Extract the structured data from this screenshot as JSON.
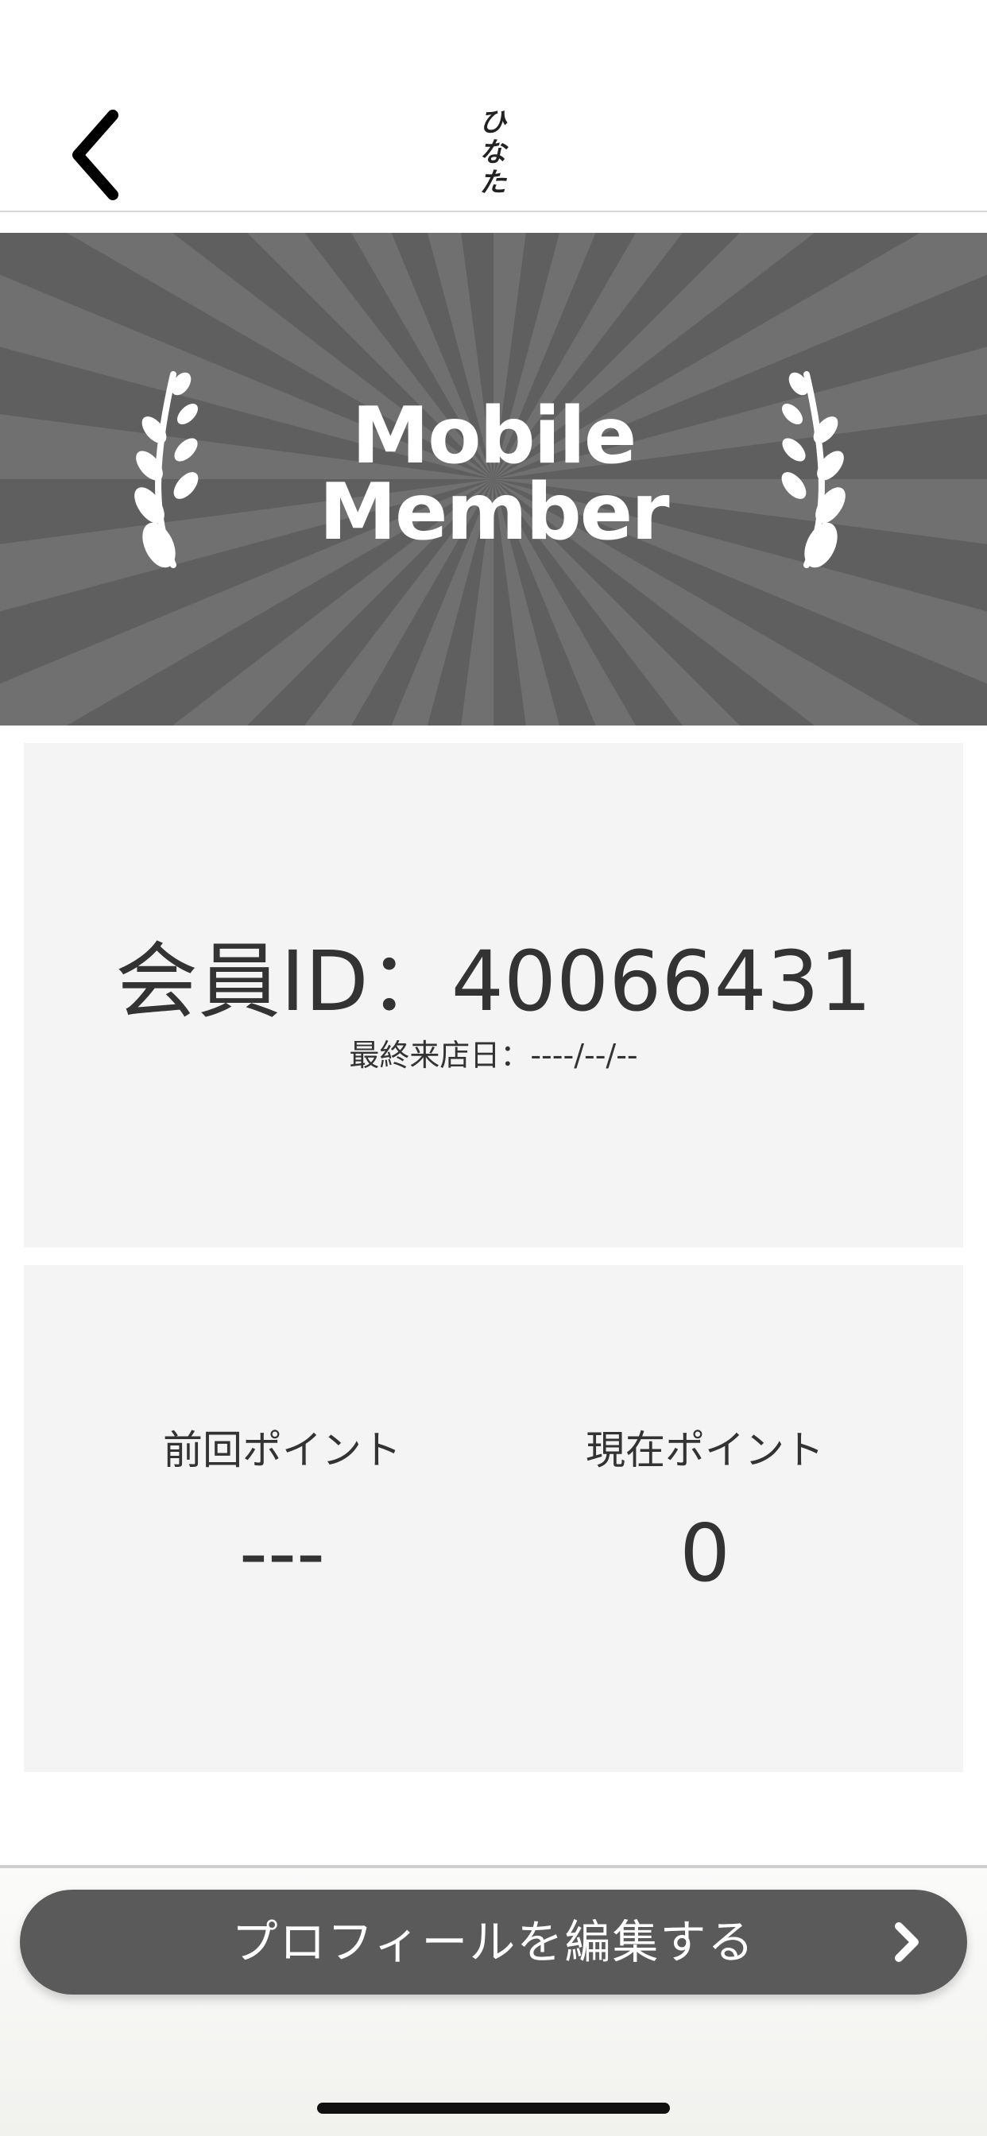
{
  "header": {
    "back_icon": "chevron-left-icon",
    "logo_chars": [
      "ひ",
      "な",
      "た"
    ]
  },
  "banner": {
    "title_line1": "Mobile",
    "title_line2": "Member",
    "left_icon": "laurel-left-icon",
    "right_icon": "laurel-right-icon",
    "colors": {
      "background": "#5f5f5f",
      "rays": "#707070"
    }
  },
  "member": {
    "id_text": "会員ID：40066431",
    "last_visit_text": "最終来店日：----/--/--"
  },
  "points": {
    "previous_label": "前回ポイント",
    "previous_value": "---",
    "current_label": "現在ポイント",
    "current_value": "0"
  },
  "footer": {
    "edit_profile_label": "プロフィールを編集する",
    "edit_profile_icon": "chevron-right-icon",
    "button_color": "#5a5a5a"
  }
}
